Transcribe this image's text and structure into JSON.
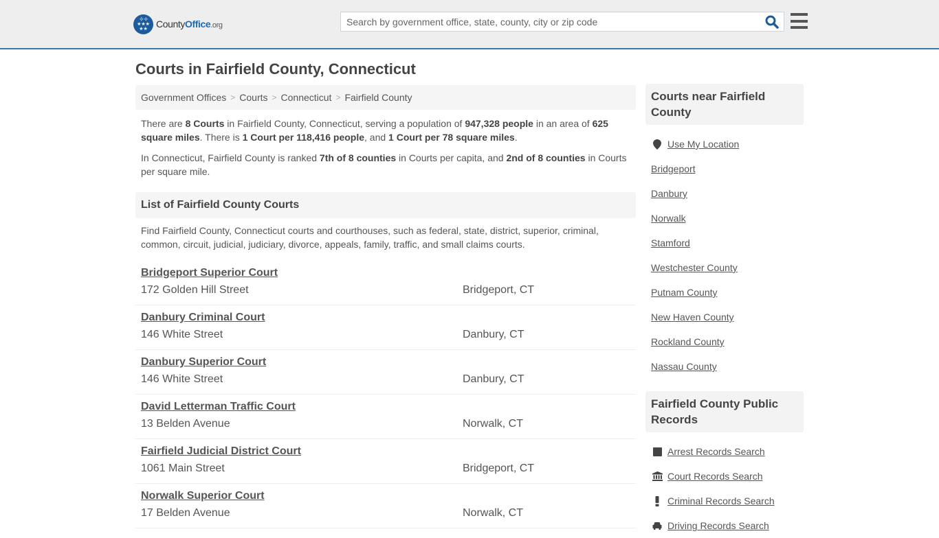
{
  "header": {
    "logo": {
      "name_part1": "County",
      "name_part2": "Office",
      "tld": ".org"
    },
    "search": {
      "placeholder": "Search by government office, state, county, city or zip code",
      "value": ""
    },
    "icons": {
      "search": "search-icon",
      "menu": "hamburger-menu-icon",
      "logo": "eagle-stars-icon"
    }
  },
  "page": {
    "title": "Courts in Fairfield County, Connecticut"
  },
  "breadcrumb": [
    {
      "label": "Government Offices"
    },
    {
      "label": "Courts"
    },
    {
      "label": "Connecticut"
    },
    {
      "label": "Fairfield County"
    }
  ],
  "intro": {
    "p1": {
      "t1": "There are ",
      "b1": "8 Courts",
      "t2": " in Fairfield County, Connecticut, serving a population of ",
      "b2": "947,328 people",
      "t3": " in an area of ",
      "b3": "625 square miles",
      "t4": ". There is ",
      "b4": "1 Court per 118,416 people",
      "t5": ", and ",
      "b5": "1 Court per 78 square miles",
      "t6": "."
    },
    "p2": {
      "t1": "In Connecticut, Fairfield County is ranked ",
      "b1": "7th of 8 counties",
      "t2": " in Courts per capita, and ",
      "b2": "2nd of 8 counties",
      "t3": " in Courts per square mile."
    }
  },
  "list_section": {
    "title": "List of Fairfield County Courts",
    "description": "Find Fairfield County, Connecticut courts and courthouses, such as federal, state, district, superior, criminal, common, circuit, judicial, judiciary, divorce, appeals, family, traffic, and small claims courts."
  },
  "courts": [
    {
      "name": "Bridgeport Superior Court",
      "address": "172 Golden Hill Street",
      "city": "Bridgeport, CT"
    },
    {
      "name": "Danbury Criminal Court",
      "address": "146 White Street",
      "city": "Danbury, CT"
    },
    {
      "name": "Danbury Superior Court",
      "address": "146 White Street",
      "city": "Danbury, CT"
    },
    {
      "name": "David Letterman Traffic Court",
      "address": "13 Belden Avenue",
      "city": "Norwalk, CT"
    },
    {
      "name": "Fairfield Judicial District Court",
      "address": "1061 Main Street",
      "city": "Bridgeport, CT"
    },
    {
      "name": "Norwalk Superior Court",
      "address": "17 Belden Avenue",
      "city": "Norwalk, CT"
    }
  ],
  "sidebar": {
    "nearby": {
      "title": "Courts near Fairfield County",
      "location_link": "Use My Location",
      "links": [
        "Bridgeport",
        "Danbury",
        "Norwalk",
        "Stamford",
        "Westchester County",
        "Putnam County",
        "New Haven County",
        "Rockland County",
        "Nassau County"
      ]
    },
    "records": {
      "title": "Fairfield County Public Records",
      "links": [
        {
          "label": "Arrest Records Search",
          "icon": "square-icon"
        },
        {
          "label": "Court Records Search",
          "icon": "courthouse-icon"
        },
        {
          "label": "Criminal Records Search",
          "icon": "exclamation-icon"
        },
        {
          "label": "Driving Records Search",
          "icon": "car-icon"
        }
      ]
    }
  }
}
